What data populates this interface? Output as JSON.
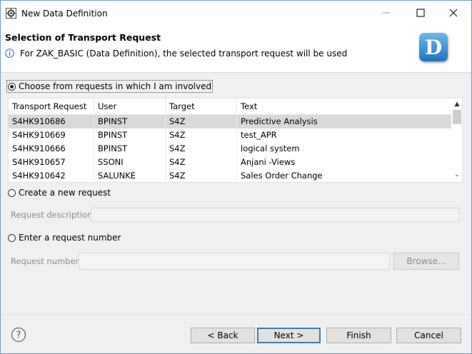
{
  "window": {
    "title": "New Data Definition",
    "minimize_label": "—",
    "maximize_label": "☐",
    "close_label": "✕"
  },
  "banner": {
    "title": "Selection of Transport Request",
    "message": "For ZAK_BASIC (Data Definition), the selected transport request will be used",
    "logo_letter": "D",
    "logo_color": "#1f73c0"
  },
  "options": {
    "choose_label": "Choose from requests in which I am involved",
    "create_label": "Create a new request",
    "enter_label": "Enter a request number",
    "selected": "choose"
  },
  "table": {
    "columns": [
      "Transport Request",
      "User",
      "Target",
      "Text"
    ],
    "rows": [
      [
        "S4HK910686",
        "BPINST",
        "S4Z",
        "Predictive Analysis"
      ],
      [
        "S4HK910669",
        "BPINST",
        "S4Z",
        "test_APR"
      ],
      [
        "S4HK910666",
        "BPINST",
        "S4Z",
        "logical system"
      ],
      [
        "S4HK910657",
        "SSONI",
        "S4Z",
        "Anjani -Views"
      ],
      [
        "S4HK910642",
        "SALUNKE",
        "S4Z",
        "Sales Order Change"
      ]
    ],
    "selected_row": 0,
    "scroll_up": "▲",
    "scroll_down": "⌄"
  },
  "fields": {
    "request_description_label": "Request description:",
    "request_description_value": "",
    "request_number_label": "Request number:",
    "request_number_value": "",
    "browse_label": "Browse..."
  },
  "footer": {
    "help_icon": "?",
    "back_label": "< Back",
    "next_label": "Next >",
    "finish_label": "Finish",
    "cancel_label": "Cancel"
  },
  "colors": {
    "window_border": "#6f9fc8",
    "selected_row": "#d9d9d9",
    "default_button_border": "#3c7fb1"
  }
}
